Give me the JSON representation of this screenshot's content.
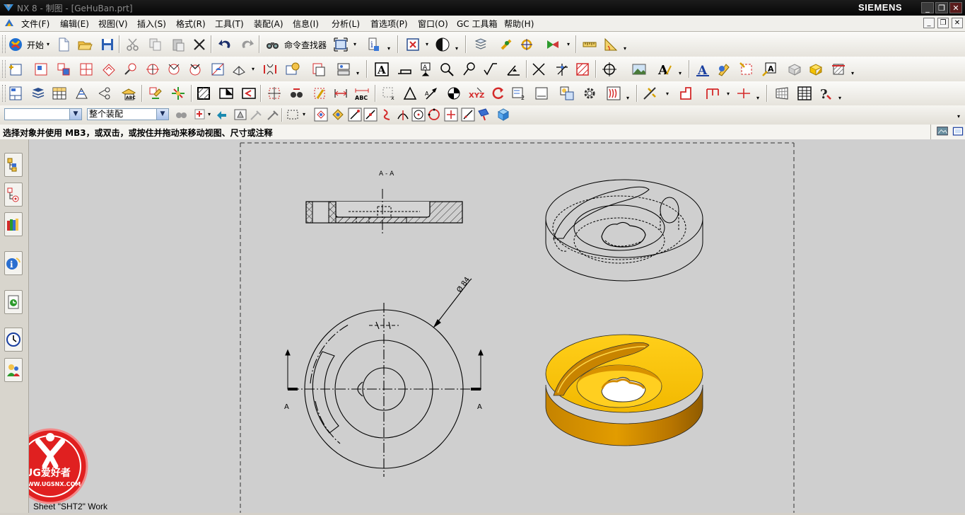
{
  "window": {
    "title": "NX 8 - 制图 - [GeHuBan.prt]",
    "brand": "SIEMENS",
    "controls": {
      "minimize": "_",
      "restore": "❐",
      "close": "✕"
    }
  },
  "menu": [
    "文件(F)",
    "编辑(E)",
    "视图(V)",
    "插入(S)",
    "格式(R)",
    "工具(T)",
    "装配(A)",
    "信息(I)",
    "分析(L)",
    "首选项(P)",
    "窗口(O)",
    "GC 工具箱",
    "帮助(H)"
  ],
  "toolbar": {
    "start_label": "开始",
    "command_finder_label": "命令查找器"
  },
  "selection_bar": {
    "type_filter_value": "",
    "scope_value": "整个装配"
  },
  "status": {
    "message": "选择对象并使用 MB3，或双击，或按住并拖动来移动视图、尺寸或注释"
  },
  "drawing": {
    "section_label": "A - A",
    "diameter_note": "Ø 84",
    "arrow_label_left": "A",
    "arrow_label_right": "A",
    "sheet_label": "Sheet \"SHT2\" Work"
  },
  "watermark": {
    "brand": "UG爱好者",
    "url": "WWW.UGSNX.COM"
  },
  "colors": {
    "part_fill": "#f2b500",
    "part_shadow": "#b57a00",
    "canvas": "#cfcfcf",
    "titlebar": "#0a0a0a"
  }
}
